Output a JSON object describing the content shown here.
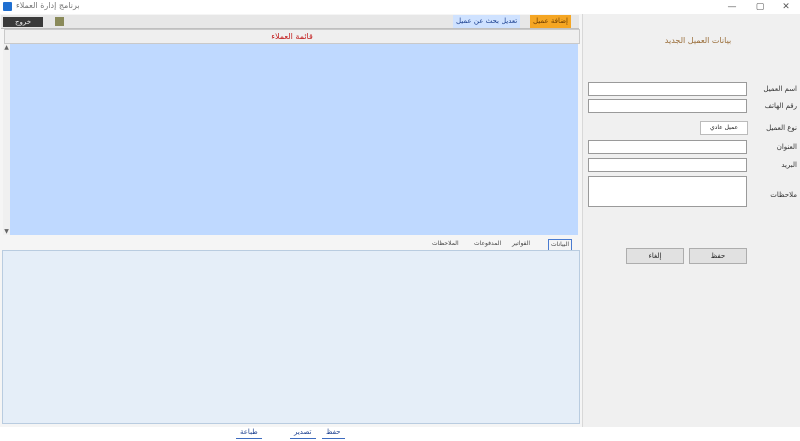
{
  "window": {
    "title": "برنامج إدارة العملاء",
    "minimize_label": "—",
    "maximize_label": "▢",
    "close_label": "✕"
  },
  "toolbar": {
    "tabs": [
      {
        "label": "إضافة عميل"
      },
      {
        "label": "تعديل"
      },
      {
        "label": "بحث عن عميل"
      }
    ],
    "dark_button_label": "خروج"
  },
  "list": {
    "header": "قائمة العملاء"
  },
  "subtabs": [
    {
      "label": "البيانات"
    },
    {
      "label": "الفواتير"
    },
    {
      "label": "المدفوعات"
    },
    {
      "label": "الملاحظات"
    }
  ],
  "bottom_buttons": [
    {
      "label": "طباعة"
    },
    {
      "label": "تصدير"
    },
    {
      "label": "حفظ"
    }
  ],
  "form": {
    "heading": "بيانات العميل الجديد",
    "fields": [
      {
        "label": "اسم العميل",
        "value": ""
      },
      {
        "label": "رقم الهاتف",
        "value": ""
      },
      {
        "label": "نوع العميل",
        "value": "عميل عادي"
      },
      {
        "label": "العنوان",
        "value": ""
      },
      {
        "label": "البريد",
        "value": ""
      },
      {
        "label": "ملاحظات",
        "value": ""
      }
    ],
    "save_label": "حفظ",
    "cancel_label": "إلغاء"
  },
  "colors": {
    "list_bg": "#bfd9ff",
    "detail_bg": "#e5eef8",
    "active_tab": "#f5a623",
    "header_text": "#c21e1e"
  }
}
